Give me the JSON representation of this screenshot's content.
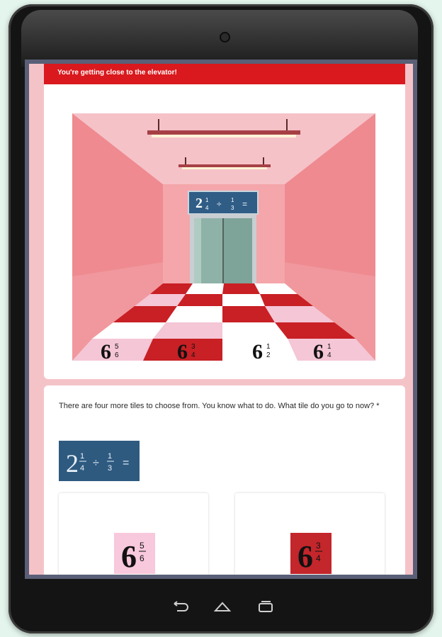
{
  "banner": {
    "text": "You're getting close to the elevator!"
  },
  "question": {
    "text": "There are four more tiles to choose from. You know what to do. What tile do you go to now? *"
  },
  "equation": {
    "whole": "2",
    "num": "1",
    "den": "4",
    "divide": "÷",
    "num2": "1",
    "den2": "3",
    "equals": "="
  },
  "floor_tiles": [
    {
      "whole": "6",
      "num": "5",
      "den": "6"
    },
    {
      "whole": "6",
      "num": "3",
      "den": "4"
    },
    {
      "whole": "6",
      "num": "1",
      "den": "2"
    },
    {
      "whole": "6",
      "num": "1",
      "den": "4"
    }
  ],
  "choices": [
    {
      "whole": "6",
      "num": "5",
      "den": "6",
      "bg": "#f8c8dc"
    },
    {
      "whole": "6",
      "num": "3",
      "den": "4",
      "bg": "#c3262b"
    }
  ],
  "colors": {
    "banner": "#d9191d",
    "screen_bg": "#f4c3c8",
    "equation_bg": "#2e5a80"
  },
  "nav_icons": [
    "back-icon",
    "home-icon",
    "recents-icon"
  ]
}
